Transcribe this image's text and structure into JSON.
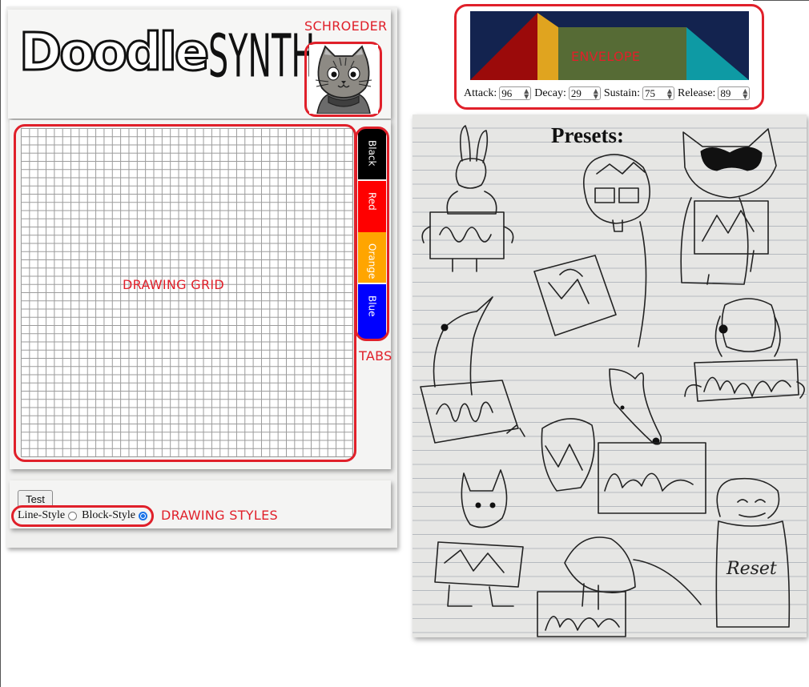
{
  "app": {
    "logo_part1": "Doodle",
    "logo_part2": "SYNTH"
  },
  "annotations": {
    "schroeder": "SCHROEDER",
    "drawing_grid": "DRAWING GRID",
    "tabs": "TABS",
    "drawing_styles": "DRAWING STYLES",
    "envelope": "ENVELOPE"
  },
  "tabs": [
    {
      "label": "Black",
      "color": "#000000"
    },
    {
      "label": "Red",
      "color": "#ff0000"
    },
    {
      "label": "Orange",
      "color": "#ffa500"
    },
    {
      "label": "Blue",
      "color": "#0000ff"
    }
  ],
  "controls": {
    "test_label": "Test",
    "line_style_label": "Line-Style",
    "block_style_label": "Block-Style",
    "selected_style": "Block-Style"
  },
  "envelope": {
    "attack_label": "Attack:",
    "attack": "96",
    "decay_label": "Decay:",
    "decay": "29",
    "sustain_label": "Sustain:",
    "sustain": "75",
    "release_label": "Release:",
    "release": "89",
    "colors": {
      "background": "#13234f",
      "attack": "#9b0a0a",
      "decay": "#e0a41f",
      "sustain": "#566b35",
      "release": "#0e9aa4"
    }
  },
  "presets": {
    "title": "Presets:",
    "reset_label": "Reset"
  },
  "accent_color": "#e0202a"
}
